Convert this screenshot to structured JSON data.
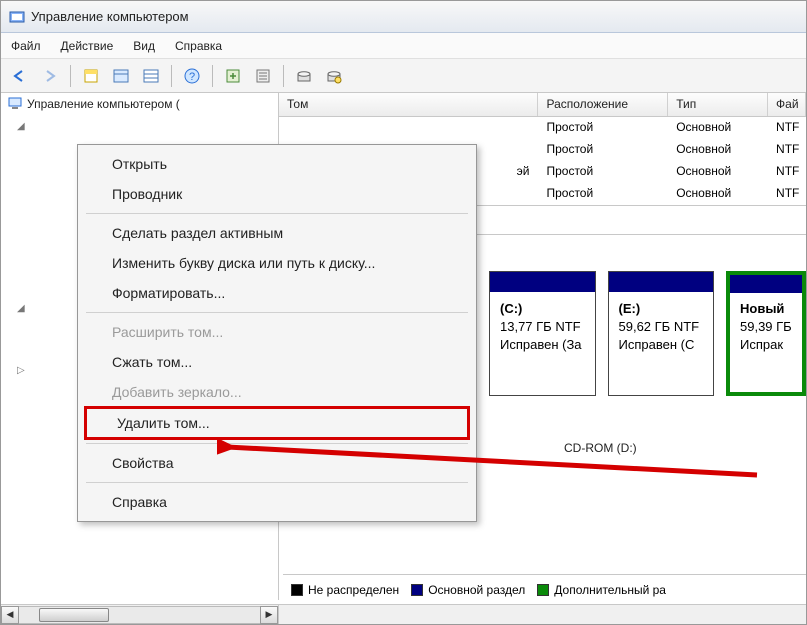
{
  "window": {
    "title": "Управление компьютером"
  },
  "menubar": {
    "file": "Файл",
    "action": "Действие",
    "view": "Вид",
    "help": "Справка"
  },
  "tree": {
    "root": "Управление компьютером ("
  },
  "table": {
    "headers": {
      "volume": "Том",
      "layout": "Расположение",
      "type": "Тип",
      "fs": "Фай"
    },
    "rows": [
      {
        "volume": "",
        "layout": "Простой",
        "type": "Основной",
        "fs": "NTF"
      },
      {
        "volume": "",
        "layout": "Простой",
        "type": "Основной",
        "fs": "NTF"
      },
      {
        "volume": "эй",
        "layout": "Простой",
        "type": "Основной",
        "fs": "NTF"
      },
      {
        "volume": "",
        "layout": "Простой",
        "type": "Основной",
        "fs": "NTF"
      }
    ]
  },
  "context": {
    "open": "Открыть",
    "explorer": "Проводник",
    "make_active": "Сделать раздел активным",
    "change_letter": "Изменить букву диска или путь к диску...",
    "format": "Форматировать...",
    "extend": "Расширить том...",
    "shrink": "Сжать том...",
    "add_mirror": "Добавить зеркало...",
    "delete": "Удалить том...",
    "properties": "Свойства",
    "help": "Справка"
  },
  "partitions": {
    "c": {
      "label": "(C:)",
      "size": "13,77 ГБ NTF",
      "status": "Исправен (За"
    },
    "e": {
      "label": "(E:)",
      "size": "59,62 ГБ NTF",
      "status": "Исправен (С"
    },
    "new": {
      "label": "Новый",
      "size": "59,39 ГБ",
      "status": "Испрак"
    }
  },
  "cdrom": "CD-ROM (D:)",
  "legend": {
    "unalloc": "Не распределен",
    "primary": "Основной раздел",
    "extended": "Дополнительный ра"
  }
}
